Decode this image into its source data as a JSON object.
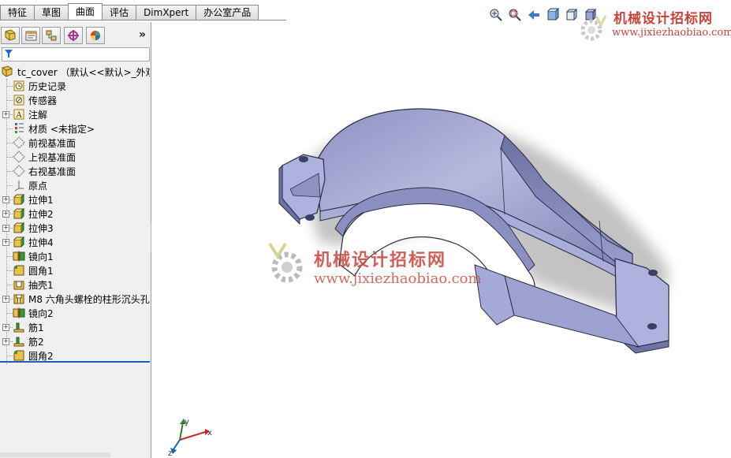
{
  "tabs": [
    {
      "label": "特征",
      "active": false
    },
    {
      "label": "草图",
      "active": false
    },
    {
      "label": "曲面",
      "active": true
    },
    {
      "label": "评估",
      "active": false
    },
    {
      "label": "DimXpert",
      "active": false
    },
    {
      "label": "办公室产品",
      "active": false
    }
  ],
  "panel": {
    "toolbar_icons": [
      "feature-manager-icon",
      "property-manager-icon",
      "configuration-manager-icon",
      "dimxpert-manager-icon",
      "display-manager-icon"
    ],
    "more_glyph": "»",
    "filter_icon": "filter-icon",
    "root_label": "tc_cover （默认<<默认>_外观 显",
    "items": [
      {
        "label": "历史记录",
        "icon": "history-icon",
        "expandable": false
      },
      {
        "label": "传感器",
        "icon": "sensor-icon",
        "expandable": false
      },
      {
        "label": "注解",
        "icon": "annotation-icon",
        "expandable": true
      },
      {
        "label": "材质 <未指定>",
        "icon": "material-icon",
        "expandable": false
      },
      {
        "label": "前视基准面",
        "icon": "plane-icon",
        "expandable": false
      },
      {
        "label": "上视基准面",
        "icon": "plane-icon",
        "expandable": false
      },
      {
        "label": "右视基准面",
        "icon": "plane-icon",
        "expandable": false
      },
      {
        "label": "原点",
        "icon": "origin-icon",
        "expandable": false
      },
      {
        "label": "拉伸1",
        "icon": "extrude-icon",
        "expandable": true
      },
      {
        "label": "拉伸2",
        "icon": "extrude-icon",
        "expandable": true
      },
      {
        "label": "拉伸3",
        "icon": "extrude-icon",
        "expandable": true
      },
      {
        "label": "拉伸4",
        "icon": "extrude-icon",
        "expandable": true
      },
      {
        "label": "镜向1",
        "icon": "mirror-icon",
        "expandable": false
      },
      {
        "label": "圆角1",
        "icon": "fillet-icon",
        "expandable": false
      },
      {
        "label": "抽壳1",
        "icon": "shell-icon",
        "expandable": false
      },
      {
        "label": "M8 六角头螺栓的柱形沉头孔",
        "icon": "hole-icon",
        "expandable": true
      },
      {
        "label": "镜向2",
        "icon": "mirror-icon",
        "expandable": false
      },
      {
        "label": "筋1",
        "icon": "rib-icon",
        "expandable": true
      },
      {
        "label": "筋2",
        "icon": "rib-icon",
        "expandable": true
      },
      {
        "label": "圆角2",
        "icon": "fillet-icon",
        "expandable": false
      }
    ]
  },
  "headsup_icons": [
    "zoom-to-fit-icon",
    "zoom-to-area-icon",
    "previous-view-icon",
    "section-view-icon",
    "view-orientation-icon",
    "display-style-icon"
  ],
  "watermark": {
    "cn": "机械设计招标网",
    "url": "www.jixiezhaobiao.com"
  },
  "triad": {
    "x": "x",
    "y": "y",
    "z": "z"
  },
  "colors": {
    "active_tab": "#ffffff",
    "panel_bg": "#f0f0f0",
    "rollback_bar": "#1f5fb5",
    "model_base": "#9a9fc8",
    "watermark": "#c9433a"
  }
}
